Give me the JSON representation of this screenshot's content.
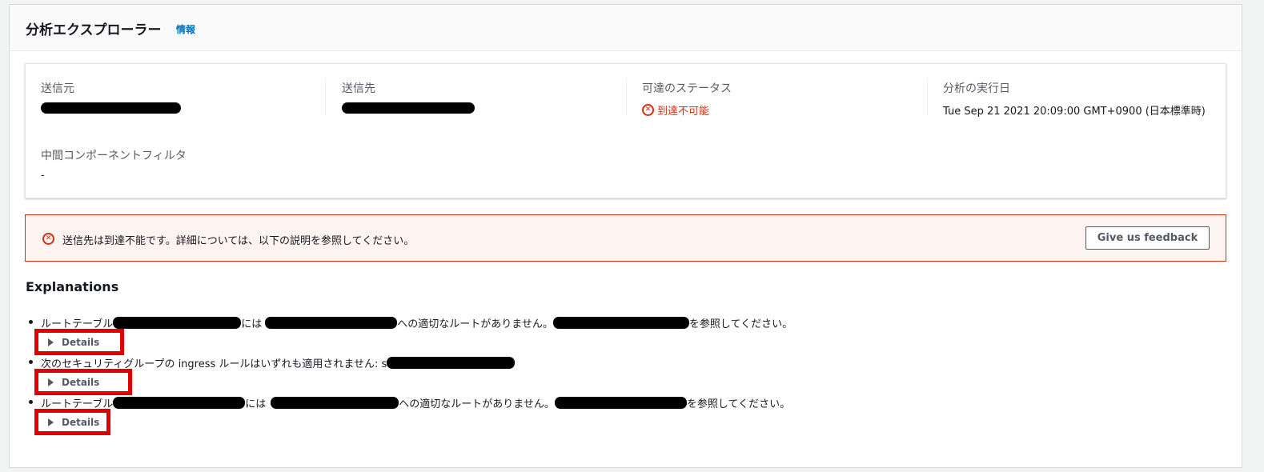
{
  "header": {
    "title": "分析エクスプローラー",
    "info_link": "情報"
  },
  "summary": {
    "source_label": "送信元",
    "destination_label": "送信先",
    "reachability_label": "可達のステータス",
    "reachability_value": "到達不可能",
    "run_date_label": "分析の実行日",
    "run_date_value": "Tue Sep 21 2021 20:09:00 GMT+0900 (日本標準時)",
    "filter_label": "中間コンポーネントフィルタ",
    "filter_value": "-"
  },
  "alert": {
    "message": "送信先は到達不能です。詳細については、以下の説明を参照してください。",
    "feedback_button": "Give us feedback"
  },
  "explanations": {
    "title": "Explanations",
    "items": [
      {
        "prefix": "ルートテーブル",
        "part2": "には",
        "part3": "への適切なルートがありません。",
        "suffix": "を参照してください。",
        "details_label": "Details"
      },
      {
        "prefix": "次のセキュリティグループの ingress ルールはいずれも適用されません: s",
        "details_label": "Details"
      },
      {
        "prefix": "ルートテーブル",
        "part2": "には",
        "part3": "への適切なルートがありません。",
        "suffix": "を参照してください。",
        "details_label": "Details"
      }
    ]
  },
  "colors": {
    "error": "#d13212",
    "link": "#0073bb",
    "highlight_box": "#e00000"
  }
}
